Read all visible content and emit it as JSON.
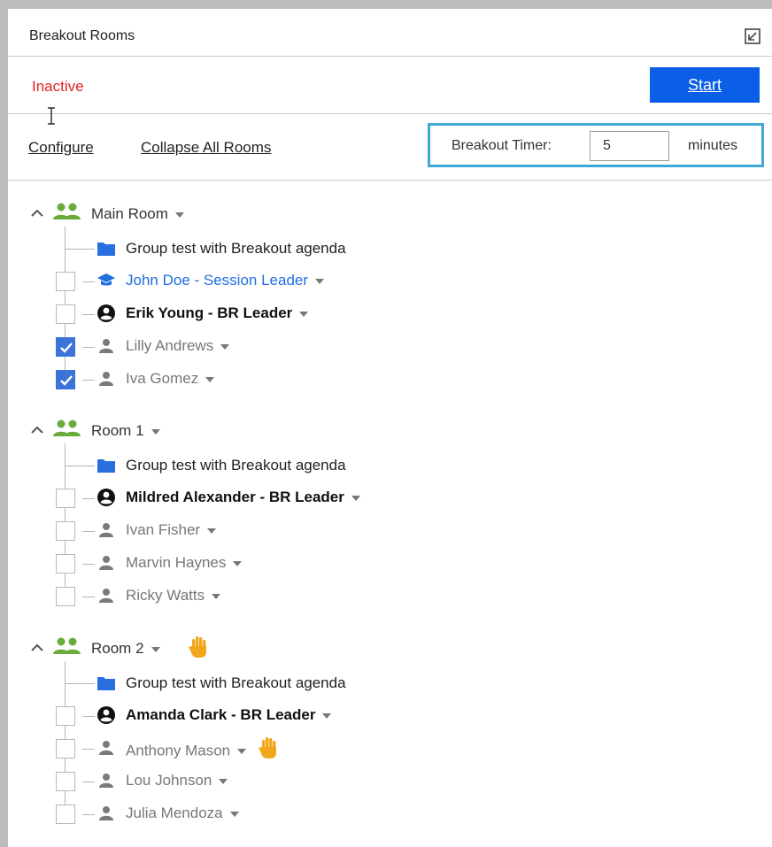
{
  "panel": {
    "title": "Breakout Rooms",
    "status": "Inactive",
    "start_label": "Start"
  },
  "toolbar": {
    "configure_label": "Configure",
    "collapse_label": "Collapse All Rooms",
    "timer_label": "Breakout Timer:",
    "timer_value": "5",
    "timer_unit": "minutes"
  },
  "colors": {
    "accent": "#0a5fe6",
    "status_inactive": "#e02424",
    "group_icon": "#6aac3a",
    "folder": "#2a6fe0",
    "session_leader": "#1f6fe0",
    "timer_outline": "#3fa9d6",
    "hand": "#f2a61c"
  },
  "rooms": [
    {
      "name": "Main Room",
      "raised_hand": false,
      "agenda": "Group test with Breakout agenda",
      "participants": [
        {
          "name": "John Doe - Session Leader",
          "role": "session-leader",
          "icon": "graduation-cap-icon",
          "checked": false,
          "raised_hand": false
        },
        {
          "name": "Erik Young - BR Leader",
          "role": "br-leader",
          "icon": "account-circle-icon",
          "checked": false,
          "raised_hand": false
        },
        {
          "name": "Lilly Andrews",
          "role": "member",
          "icon": "person-icon",
          "checked": true,
          "raised_hand": false
        },
        {
          "name": "Iva Gomez",
          "role": "member",
          "icon": "person-icon",
          "checked": true,
          "raised_hand": false
        }
      ]
    },
    {
      "name": "Room 1",
      "raised_hand": false,
      "agenda": "Group test with Breakout agenda",
      "participants": [
        {
          "name": "Mildred Alexander - BR Leader",
          "role": "br-leader",
          "icon": "account-circle-icon",
          "checked": false,
          "raised_hand": false
        },
        {
          "name": "Ivan Fisher",
          "role": "member",
          "icon": "person-icon",
          "checked": false,
          "raised_hand": false
        },
        {
          "name": "Marvin Haynes",
          "role": "member",
          "icon": "person-icon",
          "checked": false,
          "raised_hand": false
        },
        {
          "name": "Ricky Watts",
          "role": "member",
          "icon": "person-icon",
          "checked": false,
          "raised_hand": false
        }
      ]
    },
    {
      "name": "Room 2",
      "raised_hand": true,
      "agenda": "Group test with Breakout agenda",
      "participants": [
        {
          "name": "Amanda Clark - BR Leader",
          "role": "br-leader",
          "icon": "account-circle-icon",
          "checked": false,
          "raised_hand": false
        },
        {
          "name": "Anthony Mason",
          "role": "member",
          "icon": "person-icon",
          "checked": false,
          "raised_hand": true
        },
        {
          "name": "Lou Johnson",
          "role": "member",
          "icon": "person-icon",
          "checked": false,
          "raised_hand": false
        },
        {
          "name": "Julia Mendoza",
          "role": "member",
          "icon": "person-icon",
          "checked": false,
          "raised_hand": false
        }
      ]
    }
  ]
}
